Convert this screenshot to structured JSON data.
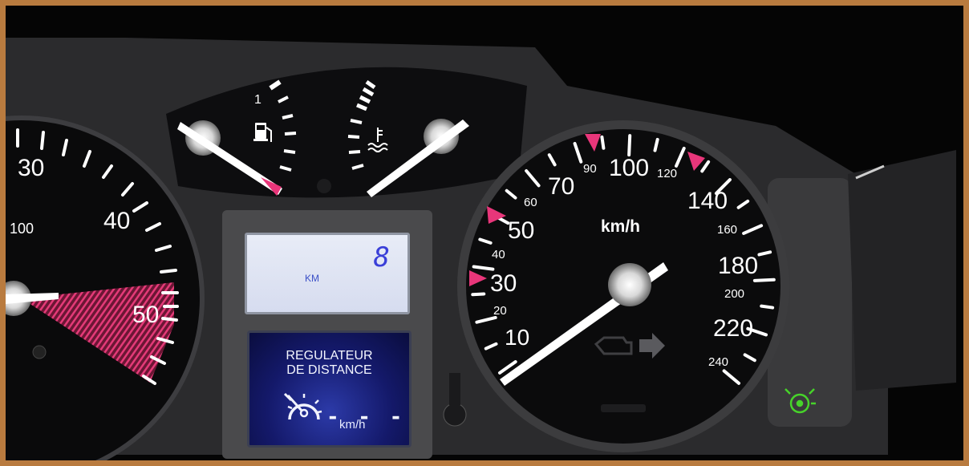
{
  "odometer": {
    "unit": "KM",
    "value": "8"
  },
  "cruise": {
    "title_line1": "REGULATEUR",
    "title_line2": "DE DISTANCE",
    "speed_value": "- - -",
    "unit": "km/h"
  },
  "speedometer": {
    "unit": "km/h",
    "major_labels": [
      "10",
      "30",
      "50",
      "70",
      "100",
      "140",
      "180",
      "220"
    ],
    "minor_labels": [
      "20",
      "40",
      "60",
      "90",
      "120",
      "160",
      "200",
      "240"
    ],
    "needle_value_kmh": 0
  },
  "tachometer": {
    "labels": [
      "30",
      "40",
      "50"
    ],
    "small_label": "100"
  },
  "fuel_gauge": {
    "full_label": "1"
  },
  "icons": [
    "fuel-pump-icon",
    "coolant-temperature-icon",
    "check-engine-icon",
    "turn-signal-arrow-icon",
    "cruise-control-icon",
    "cruise-indicator-green-icon"
  ],
  "colors": {
    "accent_pink": "#e8367a",
    "lcd_blue": "#3a3fd8",
    "indicator_green": "#47d32a"
  }
}
